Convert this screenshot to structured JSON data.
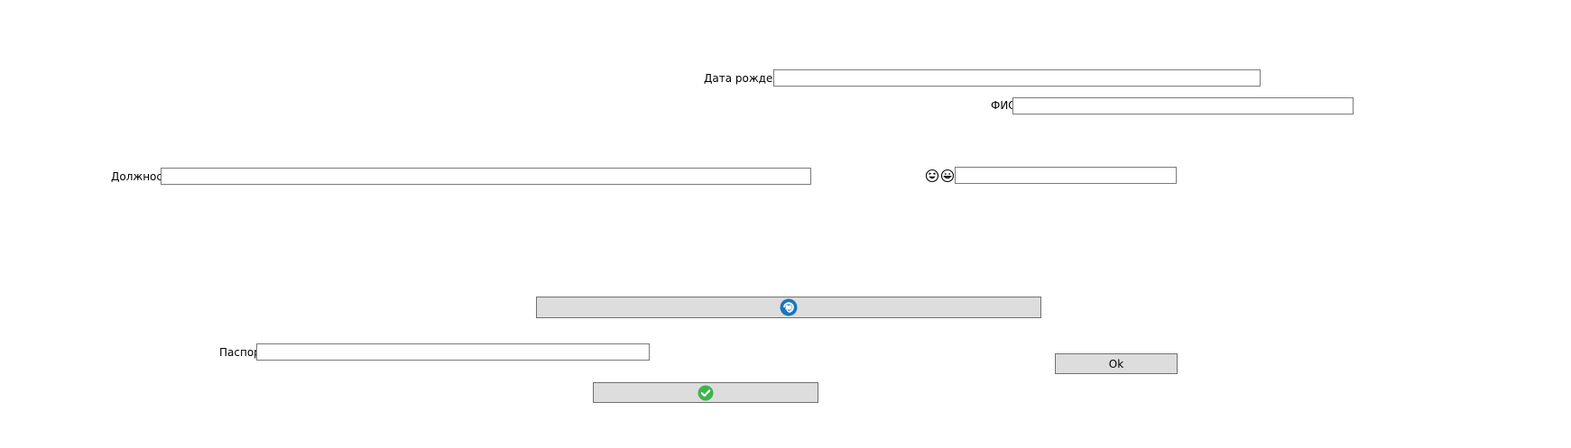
{
  "form": {
    "birth_date": {
      "label": "Дата рождения",
      "value": "",
      "placeholder": ""
    },
    "full_name": {
      "label": "ФИО",
      "value": "",
      "placeholder": ""
    },
    "position": {
      "label": "Должность",
      "value": "",
      "placeholder": ""
    },
    "emoji_field": {
      "value": "",
      "placeholder": ""
    },
    "passport": {
      "label": "Паспорт",
      "value": "",
      "placeholder": ""
    }
  },
  "buttons": {
    "refresh": {
      "icon": "refresh-icon",
      "color": "#1b75bb"
    },
    "ok": {
      "label": "Ok"
    },
    "confirm": {
      "icon": "checkmark-icon",
      "color": "#3cb54a"
    }
  },
  "icons": {
    "emoji_left": "laughing-face-icon",
    "emoji_right": "grinning-face-icon"
  },
  "colors": {
    "background": "#ffffff",
    "button_bg": "#dddddd",
    "field_border": "#7a7a7a"
  }
}
